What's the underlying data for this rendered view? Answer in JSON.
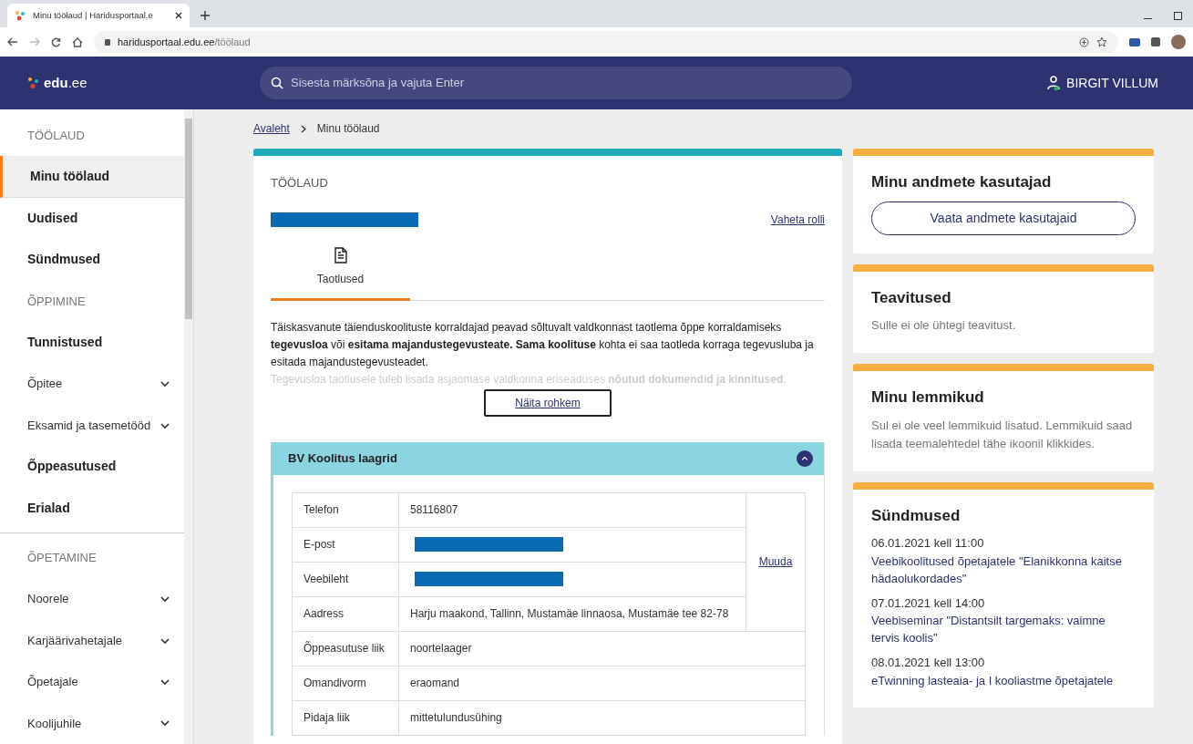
{
  "browser": {
    "tab_title": "Minu töölaud | Haridusportaal.e",
    "url_host": "haridusportaal.edu.ee",
    "url_path": "/töölaud"
  },
  "header": {
    "logo_bold": "edu",
    "logo_rest": ".ee",
    "search": {
      "placeholder": "Sisesta märksõna ja vajuta Enter"
    },
    "user": "BIRGIT VILLUM"
  },
  "sidebar": {
    "items": [
      {
        "kind": "section",
        "label": "TÖÖLAUD"
      },
      {
        "kind": "link",
        "label": "Minu töölaud",
        "selected": true
      },
      {
        "kind": "link",
        "label": "Uudised",
        "selected": false
      },
      {
        "kind": "link",
        "label": "Sündmused",
        "selected": false
      },
      {
        "kind": "section",
        "label": "ÕPPIMINE"
      },
      {
        "kind": "link",
        "label": "Tunnistused",
        "selected": false
      },
      {
        "kind": "group",
        "label": "Õpitee",
        "expanded": false
      },
      {
        "kind": "group",
        "label": "Eksamid ja tasemetööd",
        "expanded": false
      },
      {
        "kind": "link",
        "label": "Õppeasutused",
        "selected": false
      },
      {
        "kind": "link",
        "label": "Erialad",
        "selected": false
      },
      {
        "kind": "divider"
      },
      {
        "kind": "section",
        "label": "ÕPETAMINE"
      },
      {
        "kind": "group",
        "label": "Noorele",
        "expanded": false
      },
      {
        "kind": "group",
        "label": "Karjäärivahetajale",
        "expanded": false
      },
      {
        "kind": "group",
        "label": "Õpetajale",
        "expanded": false
      },
      {
        "kind": "group",
        "label": "Koolijuhile",
        "expanded": false
      }
    ]
  },
  "breadcrumb": [
    {
      "label": "Avaleht",
      "kind": "link"
    },
    {
      "label": "Minu töölaud",
      "kind": "current"
    }
  ],
  "main": {
    "overline": "TÖÖLAUD",
    "title_redacted": true,
    "switch_role": "Vaheta rolli",
    "tabs": [
      {
        "label": "Taotlused",
        "selected": true
      }
    ],
    "description": "Täiskasvanute täienduskoolituste korraldajad peavad sõltuvalt valdkonnast taotlema õppe korraldamiseks **tegevusloa** või **esitama majandustegevusteate. Sama koolituse** kohta ei saa taotleda korraga tegevusluba ja esitada majandustegevusteadet.",
    "description_faded": "Tegevusloa taotlusele tuleb lisada asjaomase valdkonna eriseaduses **nõutud dokumendid ja kinnitused**.",
    "more_button": "Näita rohkem",
    "accordion": {
      "title": "BV Koolitus laagrid",
      "expanded": true,
      "edit_link": "Muuda",
      "rows": [
        {
          "label": "Telefon",
          "kind": "text",
          "value": "58116807"
        },
        {
          "label": "E-post",
          "kind": "redacted"
        },
        {
          "label": "Veebileht",
          "kind": "redacted"
        },
        {
          "label": "Aadress",
          "kind": "text",
          "value": "Harju maakond, Tallinn, Mustamäe linnaosa, Mustamäe tee 82-78"
        },
        {
          "label": "Õppeasutuse liik",
          "kind": "text",
          "value": "noortelaager"
        },
        {
          "label": "Omandivorm",
          "kind": "text",
          "value": "eraomand"
        },
        {
          "label": "Pidaja liik",
          "kind": "text",
          "value": "mittetulundusühing"
        }
      ]
    }
  },
  "right": [
    {
      "kind": "button",
      "title": "Minu andmete kasutajad",
      "button": "Vaata andmete kasutajaid"
    },
    {
      "kind": "text",
      "title": "Teavitused",
      "text": "Sulle ei ole ühtegi teavitust."
    },
    {
      "kind": "text",
      "title": "Minu lemmikud",
      "text": "Sul ei ole veel lemmikuid lisatud. Lemmikuid saad lisada teemalehtedel tähe ikoonil klikkides."
    },
    {
      "kind": "events",
      "title": "Sündmused",
      "events": [
        {
          "date": "06.01.2021 kell 11:00",
          "title": "Veebikoolitused õpetajatele \"Elanikkonna kaitse hädaolukordades\""
        },
        {
          "date": "07.01.2021 kell 14:00",
          "title": "Veebiseminar \"Distantsilt targemaks: vaimne tervis koolis\""
        },
        {
          "date": "08.01.2021 kell 13:00",
          "title": "eTwinning lasteaia- ja I kooliastme õpetajatele"
        }
      ]
    }
  ]
}
